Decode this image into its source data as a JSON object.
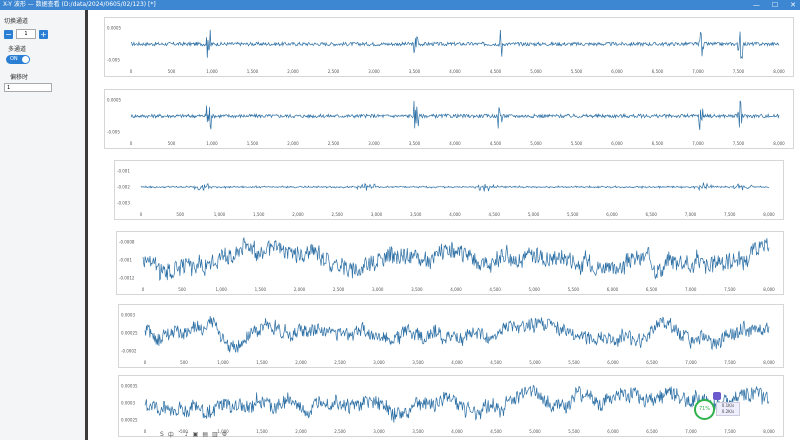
{
  "window": {
    "title": "X-Y 波形 — 数据查看 (D:/data/2024/0605/02/123) [*]",
    "minimize": "—",
    "maximize": "☐",
    "close": "✕"
  },
  "sidebar": {
    "switch_channel_label": "切换通道",
    "stepper_value": "1",
    "minus": "−",
    "plus": "+",
    "multichannel_label": "多通道",
    "toggle_text": "ON",
    "offset_label": "偏移时",
    "offset_value": "1"
  },
  "panels": [
    {
      "ticks_y": [
        "0.0005",
        "-0.005"
      ],
      "style": "impulse",
      "amp": 0.18,
      "spikes": [
        0.12,
        0.44,
        0.57,
        0.88,
        0.94
      ]
    },
    {
      "ticks_y": [
        "0.0005",
        "-0.005"
      ],
      "style": "impulse",
      "amp": 0.18,
      "spikes": [
        0.12,
        0.44,
        0.57,
        0.88,
        0.94
      ]
    },
    {
      "ticks_y": [
        "-0.001",
        "-0.002",
        "-0.003"
      ],
      "style": "burst",
      "amp": 0.12,
      "bursts": [
        0.1,
        0.36,
        0.55,
        0.9,
        0.96
      ]
    },
    {
      "ticks_y": [
        "-0.0008",
        "-0.001",
        "-0.0012"
      ],
      "style": "noise",
      "amp": 0.45
    },
    {
      "ticks_y": [
        "0.0003",
        "0.00025",
        "-0.0002"
      ],
      "style": "noise",
      "amp": 0.35
    },
    {
      "ticks_y": [
        "0.00035",
        "0.0003",
        "0.00025"
      ],
      "style": "noise",
      "amp": 0.4
    }
  ],
  "x_ticks": [
    "0",
    "500",
    "1,000",
    "1,500",
    "2,000",
    "2,500",
    "3,000",
    "3,500",
    "4,000",
    "4,500",
    "5,000",
    "5,500",
    "6,000",
    "6,500",
    "7,000",
    "7,500",
    "8,000"
  ],
  "line_color": "#2c6fa4",
  "taskbar": {
    "icons": [
      "S",
      "中",
      "ˇ",
      "♪",
      "▣",
      "▤",
      "▥",
      "⚙"
    ]
  },
  "progress_ring": {
    "text": "71%"
  },
  "mini_widget": {
    "line1": "0.1K/s",
    "line2": "0.2K/s"
  }
}
